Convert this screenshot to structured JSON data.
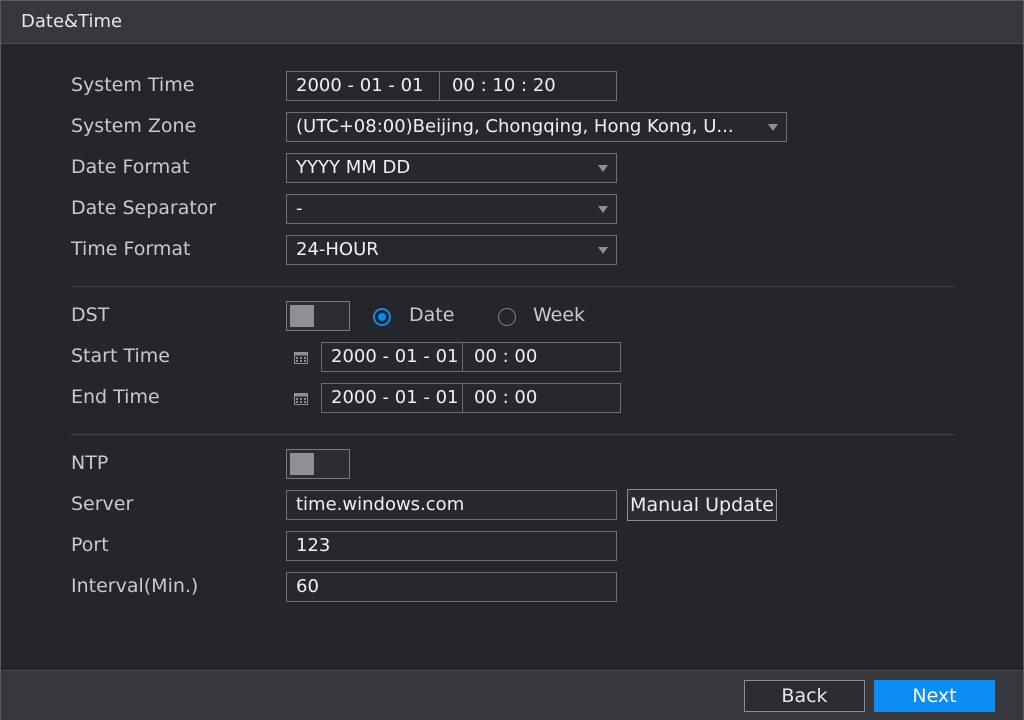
{
  "window": {
    "title": "Date&Time"
  },
  "labels": {
    "system_time": "System Time",
    "system_zone": "System Zone",
    "date_format": "Date Format",
    "date_separator": "Date Separator",
    "time_format": "Time Format",
    "dst": "DST",
    "start_time": "Start Time",
    "end_time": "End Time",
    "ntp": "NTP",
    "server": "Server",
    "port": "Port",
    "interval": "Interval(Min.)"
  },
  "system_time": {
    "date": "2000  - 01 - 01",
    "time": "00 : 10 : 20"
  },
  "system_zone": {
    "value": "(UTC+08:00)Beijing, Chongqing, Hong Kong, U..."
  },
  "date_format": {
    "value": "YYYY MM DD"
  },
  "date_separator": {
    "value": "-"
  },
  "time_format": {
    "value": "24-HOUR"
  },
  "dst": {
    "enabled": false,
    "mode_options": [
      "Date",
      "Week"
    ],
    "selected": "Date",
    "start": {
      "date": "2000 - 01 - 01",
      "time": "00 : 00"
    },
    "end": {
      "date": "2000 - 01 - 01",
      "time": "00 : 00"
    }
  },
  "ntp": {
    "enabled": false,
    "server": "time.windows.com",
    "manual_update_label": "Manual Update",
    "port": "123",
    "interval": "60"
  },
  "footer": {
    "back_label": "Back",
    "next_label": "Next"
  },
  "colors": {
    "accent": "#0c8df3",
    "background": "#24262b",
    "titlebar": "#36383d"
  },
  "icons": {
    "calendar": "calendar-icon",
    "dropdown": "chevron-down-icon"
  }
}
